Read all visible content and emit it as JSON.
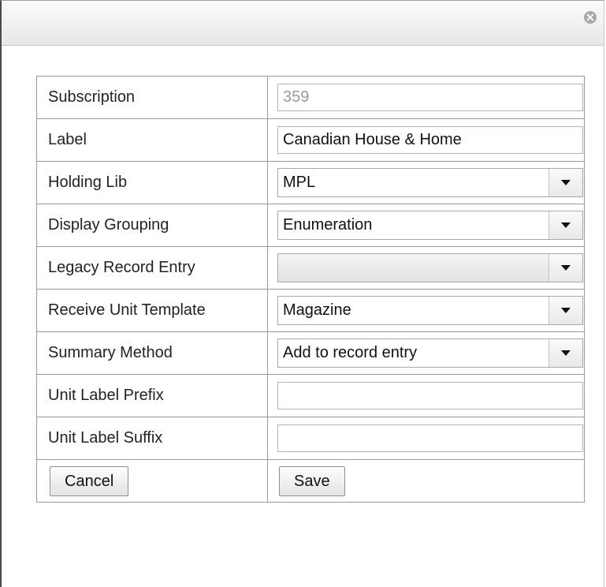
{
  "form": {
    "subscription": {
      "label": "Subscription",
      "value": "359"
    },
    "label_field": {
      "label": "Label",
      "value": "Canadian House & Home"
    },
    "holding_lib": {
      "label": "Holding Lib",
      "value": "MPL"
    },
    "display_grouping": {
      "label": "Display Grouping",
      "value": "Enumeration"
    },
    "legacy_record_entry": {
      "label": "Legacy Record Entry",
      "value": ""
    },
    "receive_unit_template": {
      "label": "Receive Unit Template",
      "value": "Magazine"
    },
    "summary_method": {
      "label": "Summary Method",
      "value": "Add to record entry"
    },
    "unit_label_prefix": {
      "label": "Unit Label Prefix",
      "value": ""
    },
    "unit_label_suffix": {
      "label": "Unit Label Suffix",
      "value": ""
    }
  },
  "buttons": {
    "cancel": "Cancel",
    "save": "Save"
  },
  "icons": {
    "close": "close-icon",
    "dropdown": "chevron-down-icon"
  }
}
